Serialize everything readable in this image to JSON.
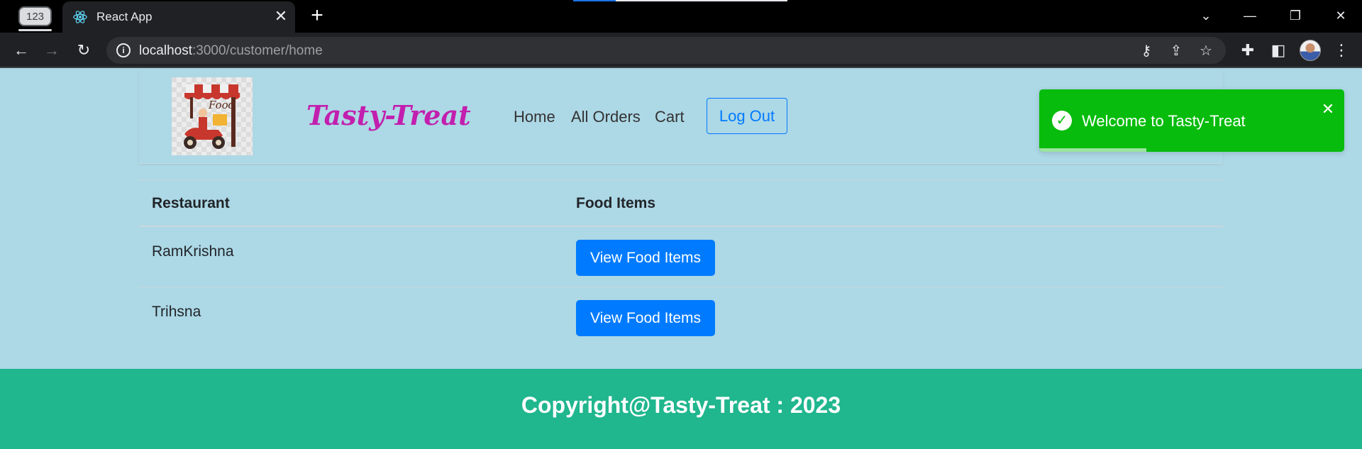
{
  "browser": {
    "tab_counter": "123",
    "tab_title": "React App",
    "url_host": "localhost",
    "url_path": ":3000/customer/home"
  },
  "nav": {
    "brand": "Tasty-Treat",
    "links": [
      "Home",
      "All Orders",
      "Cart"
    ],
    "logout_label": "Log Out"
  },
  "table": {
    "headers": [
      "Restaurant",
      "Food Items"
    ],
    "rows": [
      {
        "restaurant": "RamKrishna",
        "action": "View Food Items"
      },
      {
        "restaurant": "Trihsna",
        "action": "View Food Items"
      }
    ]
  },
  "footer": {
    "text": "Copyright@Tasty-Treat : 2023"
  },
  "toast": {
    "message": "Welcome to Tasty-Treat",
    "progress": 0.35,
    "color": "#07bc0c"
  },
  "colors": {
    "page_bg": "#add8e6",
    "brand": "#c21fae",
    "primary": "#007bff",
    "footer_bg": "#20b68e"
  }
}
